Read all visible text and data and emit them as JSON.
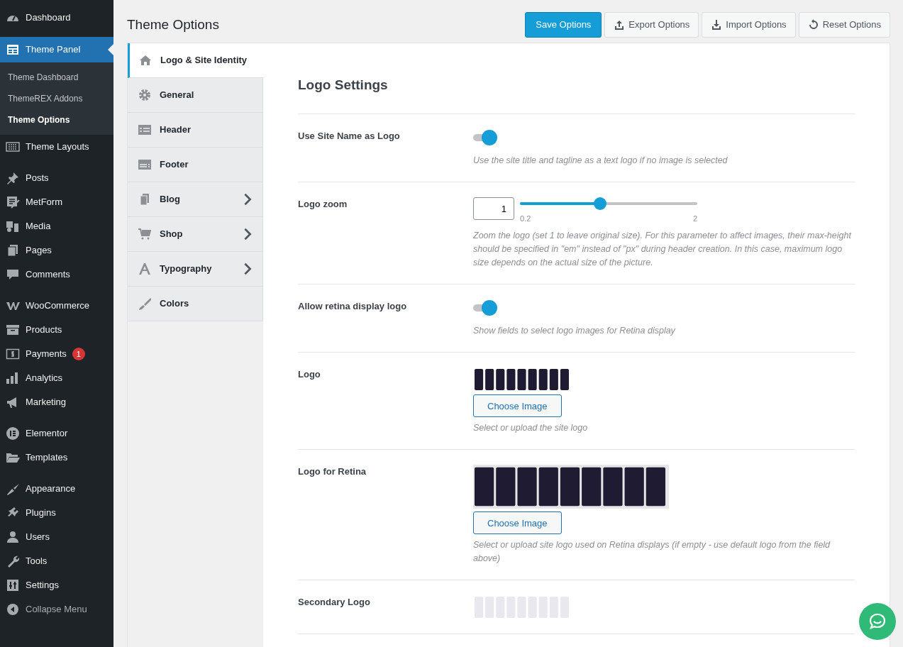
{
  "sidebar": {
    "groups": [
      [
        {
          "label": "Dashboard",
          "selected": false
        }
      ],
      [
        {
          "label": "Theme Panel",
          "selected": true,
          "children": [
            {
              "label": "Theme Dashboard",
              "selected": false
            },
            {
              "label": "ThemeREX Addons",
              "selected": false
            },
            {
              "label": "Theme Options",
              "selected": true
            }
          ]
        },
        {
          "label": "Theme Layouts",
          "selected": false
        }
      ],
      [
        {
          "label": "Posts",
          "selected": false
        },
        {
          "label": "MetForm",
          "selected": false
        },
        {
          "label": "Media",
          "selected": false
        },
        {
          "label": "Pages",
          "selected": false
        },
        {
          "label": "Comments",
          "selected": false
        }
      ],
      [
        {
          "label": "WooCommerce",
          "selected": false
        },
        {
          "label": "Products",
          "selected": false
        },
        {
          "label": "Payments",
          "selected": false,
          "badge": "1"
        },
        {
          "label": "Analytics",
          "selected": false
        },
        {
          "label": "Marketing",
          "selected": false
        }
      ],
      [
        {
          "label": "Elementor",
          "selected": false
        },
        {
          "label": "Templates",
          "selected": false
        }
      ],
      [
        {
          "label": "Appearance",
          "selected": false
        },
        {
          "label": "Plugins",
          "selected": false
        },
        {
          "label": "Users",
          "selected": false
        },
        {
          "label": "Tools",
          "selected": false
        },
        {
          "label": "Settings",
          "selected": false
        },
        {
          "label": "Collapse Menu",
          "selected": false,
          "kind": "collapse"
        }
      ]
    ]
  },
  "page": {
    "title": "Theme Options"
  },
  "toolbar": [
    {
      "label": "Save Options",
      "kind": "primary"
    },
    {
      "label": "Export Options",
      "kind": "export"
    },
    {
      "label": "Import Options",
      "kind": "import"
    },
    {
      "label": "Reset Options",
      "kind": "reset"
    }
  ],
  "option_tabs": [
    {
      "label": "Logo & Site Identity",
      "selected": true,
      "has_submenu": false
    },
    {
      "label": "General",
      "selected": false,
      "has_submenu": false
    },
    {
      "label": "Header",
      "selected": false,
      "has_submenu": false
    },
    {
      "label": "Footer",
      "selected": false,
      "has_submenu": false
    },
    {
      "label": "Blog",
      "selected": false,
      "has_submenu": true
    },
    {
      "label": "Shop",
      "selected": false,
      "has_submenu": true
    },
    {
      "label": "Typography",
      "selected": false,
      "has_submenu": true
    },
    {
      "label": "Colors",
      "selected": false,
      "has_submenu": false
    }
  ],
  "section": {
    "title": "Logo Settings",
    "settings": [
      {
        "kind": "toggle",
        "label": "Use Site Name as Logo",
        "on": true,
        "description": "Use the site title and tagline as a text logo if no image is selected"
      },
      {
        "kind": "slider",
        "label": "Logo zoom",
        "value": "1",
        "level": 0.45,
        "min_label": "0.2",
        "max_label": "2",
        "description": "Zoom the logo (set 1 to leave original size). For this parameter to affect images, their max-height should be specified in \"em\" instead of \"px\" during header creation. In this case, maximum logo size depends on the actual size of the picture."
      },
      {
        "kind": "toggle",
        "label": "Allow retina display logo",
        "on": true,
        "description": "Show fields to select logo images for Retina display"
      },
      {
        "label": "Logo",
        "button": "Choose Image",
        "description": "Select or upload the site logo"
      },
      {
        "kind": "retina_image",
        "label": "Logo for Retina",
        "button": "Choose Image",
        "description": "Select or upload site logo used on Retina displays (if empty - use default logo from the field above)"
      },
      {
        "kind": "faded_image",
        "label": "Secondary Logo"
      }
    ]
  }
}
